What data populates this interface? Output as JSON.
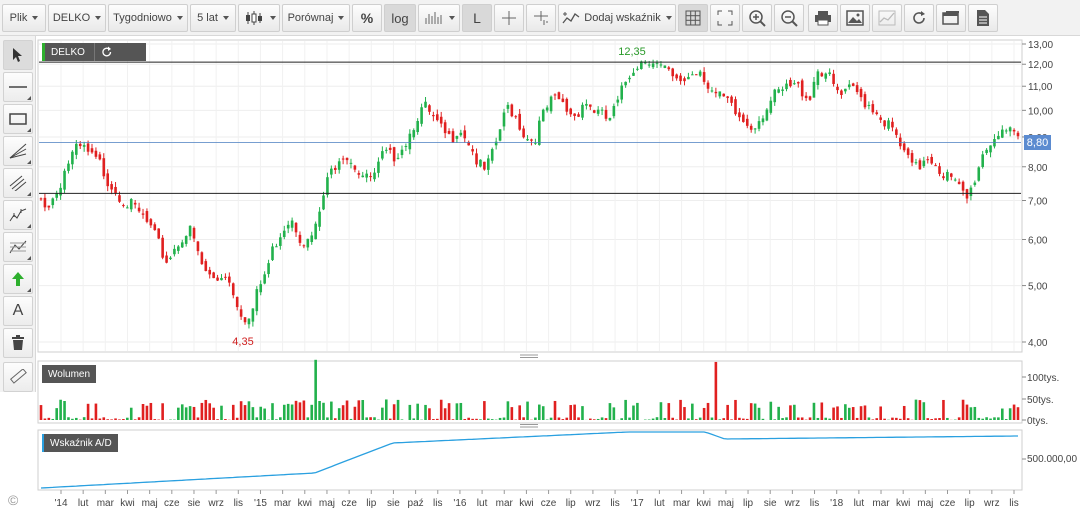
{
  "toolbar": {
    "file": "Plik",
    "symbol": "DELKO",
    "interval": "Tygodniowo",
    "range": "5 lat",
    "compare": "Porównaj",
    "percent": "%",
    "log": "log",
    "linear": "L",
    "add_indicator": "Dodaj wskaźnik"
  },
  "main": {
    "symbol_tag": "DELKO",
    "last_price": "8,80",
    "high_label": "12,35",
    "low_label": "4,35",
    "y_ticks": [
      "13,00",
      "12,00",
      "11,00",
      "10,00",
      "9,00",
      "8,00",
      "7,00",
      "6,00",
      "5,00",
      "4,00"
    ],
    "colors": {
      "up": "#22b14c",
      "down": "#e02020",
      "price_line": "#4a7fc1",
      "price_box": "#5b8bd0"
    }
  },
  "volume": {
    "title": "Wolumen",
    "y_ticks": [
      "100tys.",
      "50tys.",
      "0tys."
    ]
  },
  "ad": {
    "title": "Wskaźnik A/D",
    "y_tick": "500.000,00",
    "color": "#2aa0e0"
  },
  "x_axis": [
    "'14",
    "lut",
    "mar",
    "kwi",
    "maj",
    "cze",
    "sie",
    "wrz",
    "lis",
    "'15",
    "mar",
    "kwi",
    "maj",
    "cze",
    "lip",
    "sie",
    "paź",
    "lis",
    "'16",
    "lut",
    "mar",
    "kwi",
    "cze",
    "lip",
    "wrz",
    "lis",
    "'17",
    "lut",
    "mar",
    "kwi",
    "maj",
    "lip",
    "sie",
    "wrz",
    "lis",
    "'18",
    "lut",
    "mar",
    "kwi",
    "maj",
    "cze",
    "lip",
    "wrz",
    "lis"
  ],
  "copyright": "©",
  "chart_data": {
    "type": "candlestick",
    "title": "DELKO",
    "interval": "weekly",
    "scale": "log",
    "ylim": [
      3.9,
      13.2
    ],
    "annotations": {
      "max": 12.35,
      "min": 4.35,
      "last": 8.8
    },
    "closes": [
      7.0,
      6.9,
      7.3,
      8.0,
      8.5,
      8.6,
      8.3,
      8.1,
      7.6,
      7.3,
      7.0,
      6.8,
      6.6,
      6.3,
      5.9,
      5.5,
      5.8,
      6.1,
      6.2,
      5.5,
      5.2,
      5.1,
      5.3,
      4.9,
      4.5,
      4.35,
      4.9,
      5.3,
      5.9,
      6.3,
      6.6,
      6.1,
      5.9,
      6.3,
      7.3,
      8.0,
      8.5,
      8.3,
      7.9,
      7.6,
      7.7,
      8.4,
      8.3,
      8.6,
      9.0,
      9.8,
      10.1,
      9.6,
      9.2,
      8.9,
      9.4,
      9.0,
      8.3,
      7.8,
      8.3,
      9.3,
      10.2,
      9.7,
      9.0,
      8.9,
      9.7,
      10.3,
      10.4,
      10.0,
      9.8,
      10.4,
      10.1,
      9.8,
      9.6,
      10.2,
      11.2,
      11.9,
      12.2,
      12.35,
      11.9,
      11.6,
      11.1,
      11.3,
      11.6,
      11.8,
      11.0,
      10.5,
      10.4,
      9.9,
      9.6,
      9.4,
      9.7,
      10.2,
      10.6,
      10.8,
      11.0,
      10.9,
      10.5,
      11.8,
      11.6,
      10.9,
      10.5,
      10.9,
      10.6,
      10.3,
      10.0,
      9.6,
      9.2,
      8.6,
      8.1,
      7.9,
      8.4,
      8.2,
      7.8,
      7.6,
      7.3,
      7.0,
      7.8,
      8.6,
      8.9,
      9.4,
      9.1,
      8.8
    ],
    "horizontal_lines": [
      12.1,
      7.2,
      8.8
    ],
    "volume_peaks": [
      "maj '15",
      "maj '17"
    ]
  }
}
